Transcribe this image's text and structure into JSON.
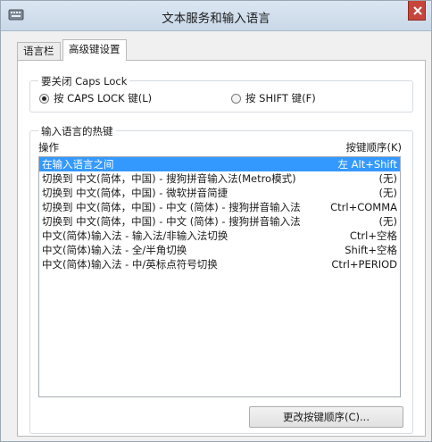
{
  "window": {
    "title": "文本服务和输入语言",
    "icon": "keyboard-app-icon"
  },
  "tabs": [
    {
      "label": "语言栏",
      "active": false
    },
    {
      "label": "高级键设置",
      "active": true
    }
  ],
  "caps_lock_group": {
    "label": "要关闭 Caps Lock",
    "options": [
      {
        "label": "按 CAPS LOCK 键(L)",
        "checked": true
      },
      {
        "label": "按 SHIFT 键(F)",
        "checked": false
      }
    ]
  },
  "hotkeys_group": {
    "label": "输入语言的热键",
    "col_action": "操作",
    "col_key": "按键顺序(K)",
    "rows": [
      {
        "name": "在输入语言之间",
        "key": "左 Alt+Shift",
        "selected": true
      },
      {
        "name": "切换到 中文(简体，中国) - 搜狗拼音输入法(Metro模式)",
        "key": "(无)",
        "selected": false
      },
      {
        "name": "切换到 中文(简体，中国) - 微软拼音简捷",
        "key": "(无)",
        "selected": false
      },
      {
        "name": "切换到 中文(简体，中国) - 中文 (简体) - 搜狗拼音输入法",
        "key": "Ctrl+COMMA",
        "selected": false
      },
      {
        "name": "切换到 中文(简体，中国) - 中文 (简体) - 搜狗拼音输入法",
        "key": "(无)",
        "selected": false
      },
      {
        "name": "中文(简体)输入法 - 输入法/非输入法切换",
        "key": "Ctrl+空格",
        "selected": false
      },
      {
        "name": "中文(简体)输入法 - 全/半角切换",
        "key": "Shift+空格",
        "selected": false
      },
      {
        "name": "中文(简体)输入法 - 中/英标点符号切换",
        "key": "Ctrl+PERIOD",
        "selected": false
      }
    ],
    "change_button": "更改按键顺序(C)..."
  },
  "colors": {
    "selection": "#3399ff",
    "close": "#c7463c"
  }
}
